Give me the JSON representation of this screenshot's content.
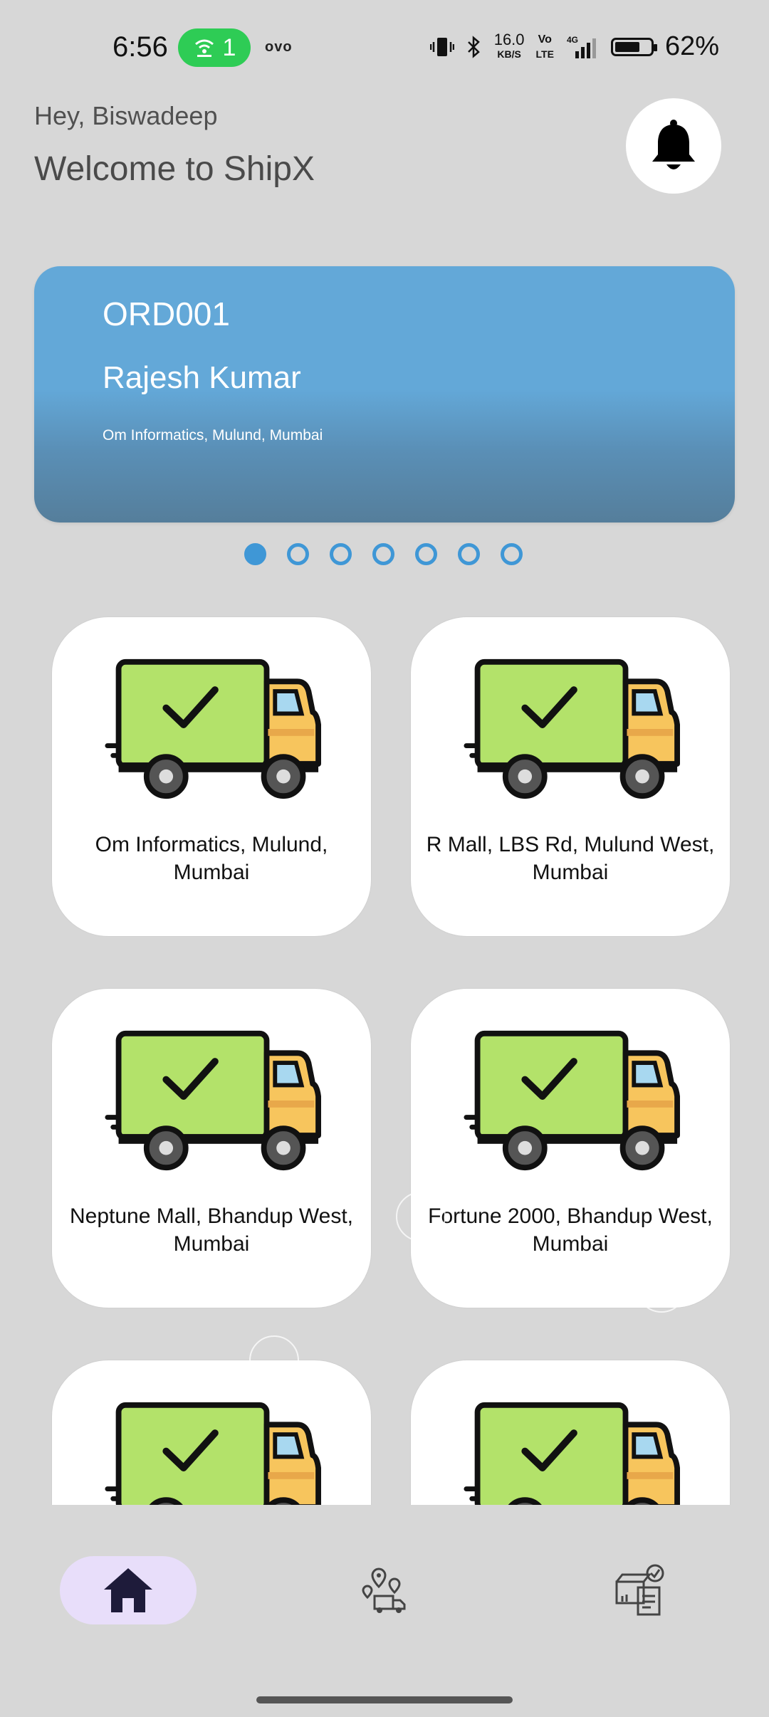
{
  "status_bar": {
    "time": "6:56",
    "hotspot_count": "1",
    "carrier_tag": "ovo",
    "speed_value": "16.0",
    "speed_unit": "KB/S",
    "volte_top": "Vo",
    "volte_bottom": "LTE",
    "network": "4G",
    "battery_percent": "62%",
    "battery_level": 0.62
  },
  "header": {
    "greeting": "Hey, Biswadeep",
    "welcome": "Welcome to ShipX",
    "bell_icon": "bell-icon"
  },
  "carousel": {
    "order_id": "ORD001",
    "customer": "Rajesh Kumar",
    "address": "Om Informatics, Mulund, Mumbai",
    "slide_count": 7,
    "active_slide": 0,
    "accent": "#63a8d8"
  },
  "cards": [
    {
      "label": "Om Informatics, Mulund, Mumbai",
      "icon": "delivery-truck-check-icon"
    },
    {
      "label": "R Mall, LBS Rd, Mulund West, Mumbai",
      "icon": "delivery-truck-check-icon"
    },
    {
      "label": "Neptune Mall, Bhandup West, Mumbai",
      "icon": "delivery-truck-check-icon"
    },
    {
      "label": "Fortune 2000, Bhandup West, Mumbai",
      "icon": "delivery-truck-check-icon"
    },
    {
      "label": "",
      "icon": "delivery-truck-check-icon"
    },
    {
      "label": "",
      "icon": "delivery-truck-check-icon"
    }
  ],
  "bottom_nav": {
    "items": [
      {
        "icon": "home-icon",
        "active": true
      },
      {
        "icon": "map-route-icon",
        "active": false
      },
      {
        "icon": "delivered-package-icon",
        "active": false
      }
    ],
    "active_pill_color": "#e8defa"
  }
}
